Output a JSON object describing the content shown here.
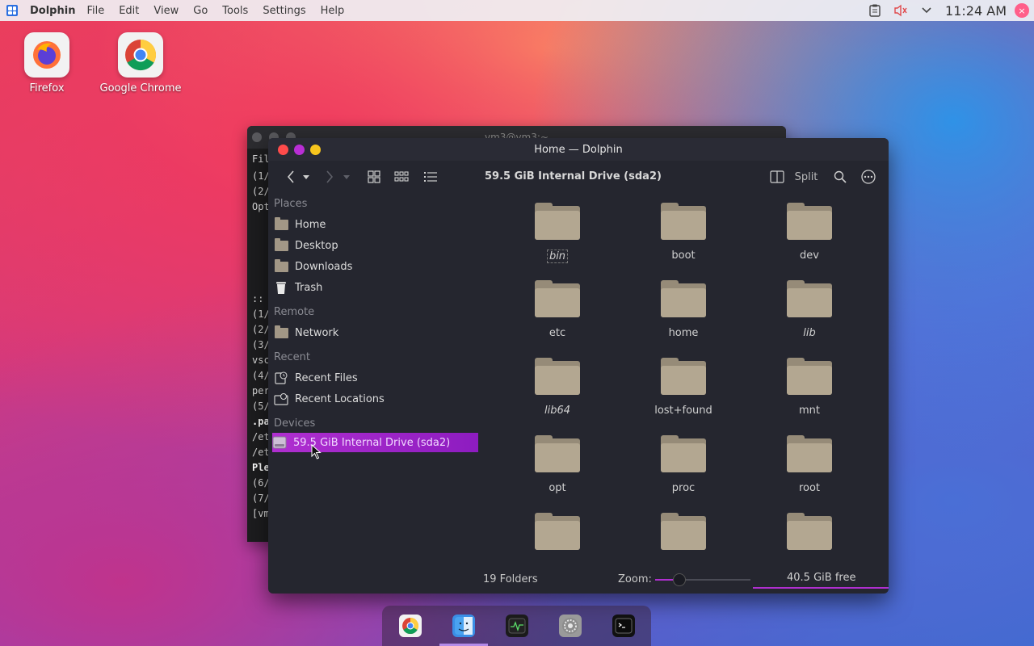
{
  "topbar": {
    "app_name": "Dolphin",
    "menus": [
      "File",
      "Edit",
      "View",
      "Go",
      "Tools",
      "Settings",
      "Help"
    ],
    "clock": "11:24 AM"
  },
  "desktop": {
    "icons": [
      {
        "label": "Firefox"
      },
      {
        "label": "Google Chrome"
      }
    ]
  },
  "terminal": {
    "title": "vm3@vm3:~",
    "menu_fragment": "Fil",
    "lines": [
      "(1/",
      "(2/",
      "Opt",
      "",
      "",
      "",
      "",
      "",
      ":: ",
      "(1/",
      "(2/",
      "(3/",
      "vsc",
      "(4/",
      "per",
      "(5/",
      ".pa",
      "/et",
      "/et",
      "Ple",
      "(6/",
      "(7/",
      "[vm"
    ]
  },
  "dolphin": {
    "title": "Home — Dolphin",
    "location": "59.5 GiB Internal Drive (sda2)",
    "split_label": "Split",
    "sidebar": {
      "places_header": "Places",
      "places": [
        "Home",
        "Desktop",
        "Downloads",
        "Trash"
      ],
      "remote_header": "Remote",
      "remote": [
        "Network"
      ],
      "recent_header": "Recent",
      "recent": [
        "Recent Files",
        "Recent Locations"
      ],
      "devices_header": "Devices",
      "devices": [
        "59.5 GiB Internal Drive (sda2)"
      ]
    },
    "folders": [
      {
        "name": "bin",
        "italic": true,
        "focused": true
      },
      {
        "name": "boot",
        "italic": false
      },
      {
        "name": "dev",
        "italic": false
      },
      {
        "name": "etc",
        "italic": false
      },
      {
        "name": "home",
        "italic": false
      },
      {
        "name": "lib",
        "italic": true
      },
      {
        "name": "lib64",
        "italic": true
      },
      {
        "name": "lost+found",
        "italic": false
      },
      {
        "name": "mnt",
        "italic": false
      },
      {
        "name": "opt",
        "italic": false
      },
      {
        "name": "proc",
        "italic": false
      },
      {
        "name": "root",
        "italic": false
      }
    ],
    "status": {
      "count": "19 Folders",
      "zoom_label": "Zoom:",
      "free": "40.5 GiB free"
    }
  },
  "colors": {
    "accent": "#b02fd0",
    "close": "#ff4b4b",
    "minimize": "#b92ed6",
    "maximize": "#f7c51d"
  },
  "dock": {
    "items": [
      "chrome-icon",
      "finder-icon",
      "system-monitor-icon",
      "settings-icon",
      "terminal-icon"
    ]
  }
}
